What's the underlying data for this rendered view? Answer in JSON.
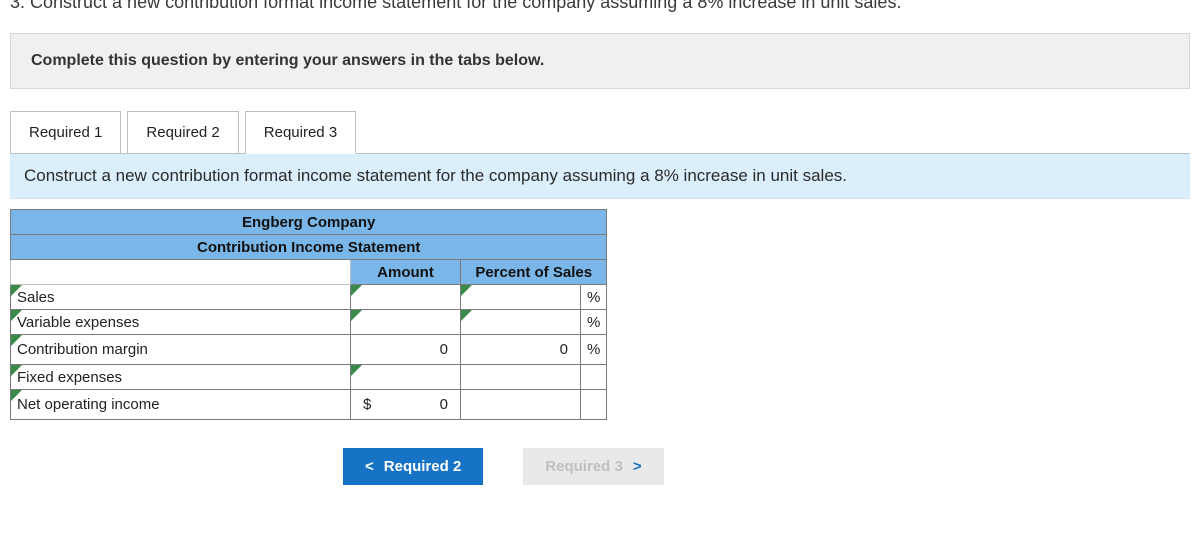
{
  "question_partial": "3. Construct a new contribution format income statement for the company assuming a 8% increase in unit sales.",
  "instruction": "Complete this question by entering your answers in the tabs below.",
  "tabs": [
    {
      "label": "Required 1"
    },
    {
      "label": "Required 2"
    },
    {
      "label": "Required 3"
    }
  ],
  "active_tab_index": 2,
  "prompt": "Construct a new contribution format income statement for the company assuming a 8% increase in unit sales.",
  "table": {
    "title1": "Engberg Company",
    "title2": "Contribution Income Statement",
    "col_amount": "Amount",
    "col_percent": "Percent of Sales",
    "rows": [
      {
        "label": "Sales",
        "amount": "",
        "percent": "",
        "unit": "%"
      },
      {
        "label": "Variable expenses",
        "amount": "",
        "percent": "",
        "unit": "%"
      },
      {
        "label": "Contribution margin",
        "amount": "0",
        "percent": "0",
        "unit": "%"
      },
      {
        "label": "Fixed expenses",
        "amount": "",
        "percent": null,
        "unit": null
      },
      {
        "label": "Net operating income",
        "amount": "0",
        "currency": "$",
        "percent": null,
        "unit": null
      }
    ]
  },
  "nav": {
    "prev": "Required 2",
    "next": "Required 3",
    "prev_icon": "<",
    "next_icon": ">"
  }
}
